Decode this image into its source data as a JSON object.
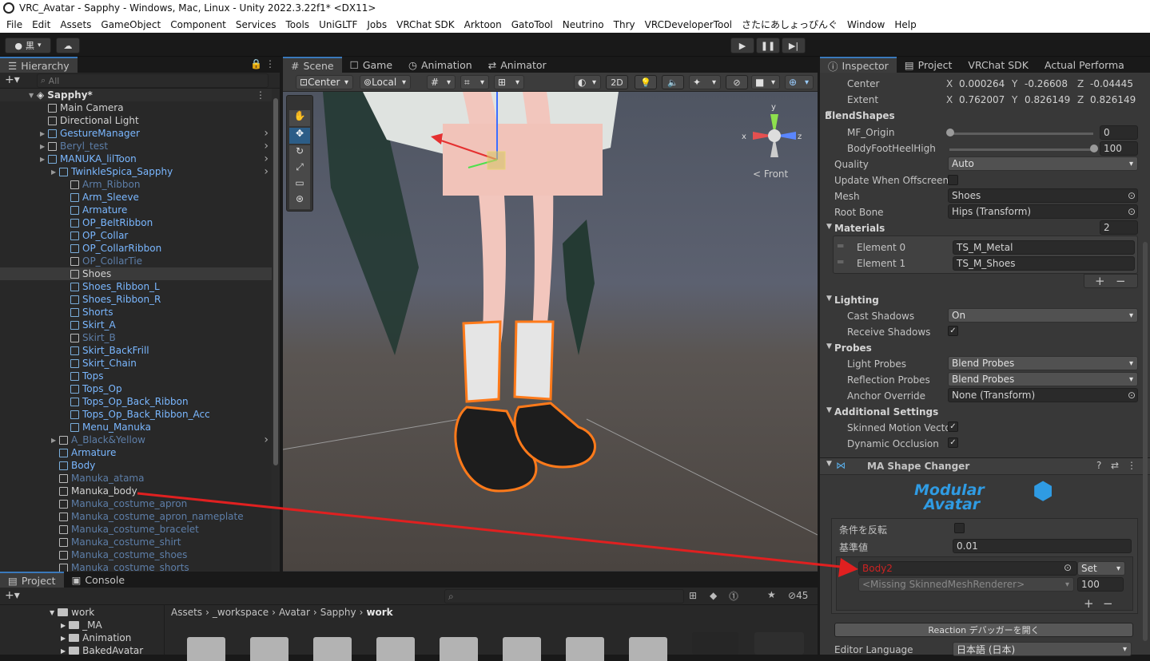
{
  "window": {
    "title": "VRC_Avatar - Sapphy - Windows, Mac, Linux - Unity 2022.3.22f1* <DX11>"
  },
  "menu": [
    "File",
    "Edit",
    "Assets",
    "GameObject",
    "Component",
    "Services",
    "Tools",
    "UniGLTF",
    "Jobs",
    "VRChat SDK",
    "Arktoon",
    "GatoTool",
    "Neutrino",
    "Thry",
    "VRCDeveloperTool",
    "さたにあしょっぴんぐ",
    "Window",
    "Help"
  ],
  "toolbar": {
    "account_label": "黒"
  },
  "hierarchy": {
    "tab": "Hierarchy",
    "search_placeholder": "All",
    "scene": "Sapphy*",
    "rows": [
      {
        "label": "Main Camera",
        "indent": 1,
        "style": "w"
      },
      {
        "label": "Directional Light",
        "indent": 1,
        "style": "w"
      },
      {
        "label": "GestureManager",
        "indent": 1,
        "style": "b",
        "arrow": true
      },
      {
        "label": "Beryl_test",
        "indent": 1,
        "style": "d",
        "arrow": true
      },
      {
        "label": "MANUKA_lilToon",
        "indent": 1,
        "style": "b",
        "arrow": true
      },
      {
        "label": "TwinkleSpica_Sapphy",
        "indent": 2,
        "style": "b",
        "arrow": true
      },
      {
        "label": "Arm_Ribbon",
        "indent": 3,
        "style": "d"
      },
      {
        "label": "Arm_Sleeve",
        "indent": 3,
        "style": "b"
      },
      {
        "label": "Armature",
        "indent": 3,
        "style": "b"
      },
      {
        "label": "OP_BeltRibbon",
        "indent": 3,
        "style": "b"
      },
      {
        "label": "OP_Collar",
        "indent": 3,
        "style": "b"
      },
      {
        "label": "OP_CollarRibbon",
        "indent": 3,
        "style": "b"
      },
      {
        "label": "OP_CollarTie",
        "indent": 3,
        "style": "d"
      },
      {
        "label": "Shoes",
        "indent": 3,
        "style": "w",
        "hl": true
      },
      {
        "label": "Shoes_Ribbon_L",
        "indent": 3,
        "style": "b"
      },
      {
        "label": "Shoes_Ribbon_R",
        "indent": 3,
        "style": "b"
      },
      {
        "label": "Shorts",
        "indent": 3,
        "style": "b"
      },
      {
        "label": "Skirt_A",
        "indent": 3,
        "style": "b"
      },
      {
        "label": "Skirt_B",
        "indent": 3,
        "style": "d"
      },
      {
        "label": "Skirt_BackFrill",
        "indent": 3,
        "style": "b"
      },
      {
        "label": "Skirt_Chain",
        "indent": 3,
        "style": "b"
      },
      {
        "label": "Tops",
        "indent": 3,
        "style": "b"
      },
      {
        "label": "Tops_Op",
        "indent": 3,
        "style": "b"
      },
      {
        "label": "Tops_Op_Back_Ribbon",
        "indent": 3,
        "style": "b"
      },
      {
        "label": "Tops_Op_Back_Ribbon_Acc",
        "indent": 3,
        "style": "b"
      },
      {
        "label": "Menu_Manuka",
        "indent": 3,
        "style": "b"
      },
      {
        "label": "A_Black&Yellow",
        "indent": 2,
        "style": "d",
        "arrow": true
      },
      {
        "label": "Armature",
        "indent": 2,
        "style": "b"
      },
      {
        "label": "Body",
        "indent": 2,
        "style": "b"
      },
      {
        "label": "Manuka_atama",
        "indent": 2,
        "style": "d"
      },
      {
        "label": "Manuka_body",
        "indent": 2,
        "style": "w"
      },
      {
        "label": "Manuka_costume_apron",
        "indent": 2,
        "style": "d"
      },
      {
        "label": "Manuka_costume_apron_nameplate",
        "indent": 2,
        "style": "d"
      },
      {
        "label": "Manuka_costume_bracelet",
        "indent": 2,
        "style": "d"
      },
      {
        "label": "Manuka_costume_shirt",
        "indent": 2,
        "style": "d"
      },
      {
        "label": "Manuka_costume_shoes",
        "indent": 2,
        "style": "d"
      },
      {
        "label": "Manuka_costume_shorts",
        "indent": 2,
        "style": "d"
      }
    ]
  },
  "scene": {
    "tabs": [
      "Scene",
      "Game",
      "Animation",
      "Animator"
    ],
    "pivot": "Center",
    "space": "Local",
    "mode2d": "2D",
    "gizmo_label": "< Front"
  },
  "inspector": {
    "tabs": [
      "Inspector",
      "Project",
      "VRChat SDK",
      "Actual Performa"
    ],
    "center": {
      "label": "Center",
      "x": "0.000264",
      "y": "-0.26608",
      "z": "-0.04445"
    },
    "extent": {
      "label": "Extent",
      "x": "0.762007",
      "y": "0.826149",
      "z": "0.826149"
    },
    "blendshapes": {
      "title": "BlendShapes",
      "items": [
        {
          "name": "MF_Origin",
          "value": "0",
          "frac": 0
        },
        {
          "name": "BodyFootHeelHigh",
          "value": "100",
          "frac": 1
        }
      ]
    },
    "quality": {
      "label": "Quality",
      "value": "Auto"
    },
    "update_offscreen": "Update When Offscreen",
    "mesh": {
      "label": "Mesh",
      "value": "Shoes"
    },
    "root_bone": {
      "label": "Root Bone",
      "value": "Hips (Transform)"
    },
    "materials": {
      "title": "Materials",
      "count": "2",
      "items": [
        {
          "label": "Element 0",
          "value": "TS_M_Metal"
        },
        {
          "label": "Element 1",
          "value": "TS_M_Shoes"
        }
      ]
    },
    "lighting": {
      "title": "Lighting",
      "cast": {
        "label": "Cast Shadows",
        "value": "On"
      },
      "receive": "Receive Shadows"
    },
    "probes": {
      "title": "Probes",
      "light": {
        "label": "Light Probes",
        "value": "Blend Probes"
      },
      "reflection": {
        "label": "Reflection Probes",
        "value": "Blend Probes"
      },
      "anchor": {
        "label": "Anchor Override",
        "value": "None (Transform)"
      }
    },
    "additional": {
      "title": "Additional Settings",
      "motion": "Skinned Motion Vecto",
      "occlusion": "Dynamic Occlusion"
    },
    "ma": {
      "title": "MA Shape Changer",
      "logo1": "Modular",
      "logo2": "Avatar",
      "invert": "条件を反転",
      "threshold_label": "基準値",
      "threshold": "0.01",
      "target": "Body2",
      "mode": "Set",
      "missing": "<Missing SkinnedMeshRenderer>",
      "value": "100",
      "reaction_btn": "Reaction デバッガーを開く",
      "editor_lang_label": "Editor Language",
      "editor_lang": "日本語 (日本)"
    }
  },
  "project": {
    "tabs": [
      "Project",
      "Console"
    ],
    "hidden_count": "45",
    "tree": [
      "work",
      "_MA",
      "Animation",
      "BakedAvatar"
    ],
    "breadcrumb": [
      "Assets",
      "_workspace",
      "Avatar",
      "Sapphy",
      "work"
    ]
  },
  "colors": {
    "accent": "#3a79bb",
    "selection_outline": "#ff7a1a",
    "annotation_arrow": "#e02020"
  }
}
